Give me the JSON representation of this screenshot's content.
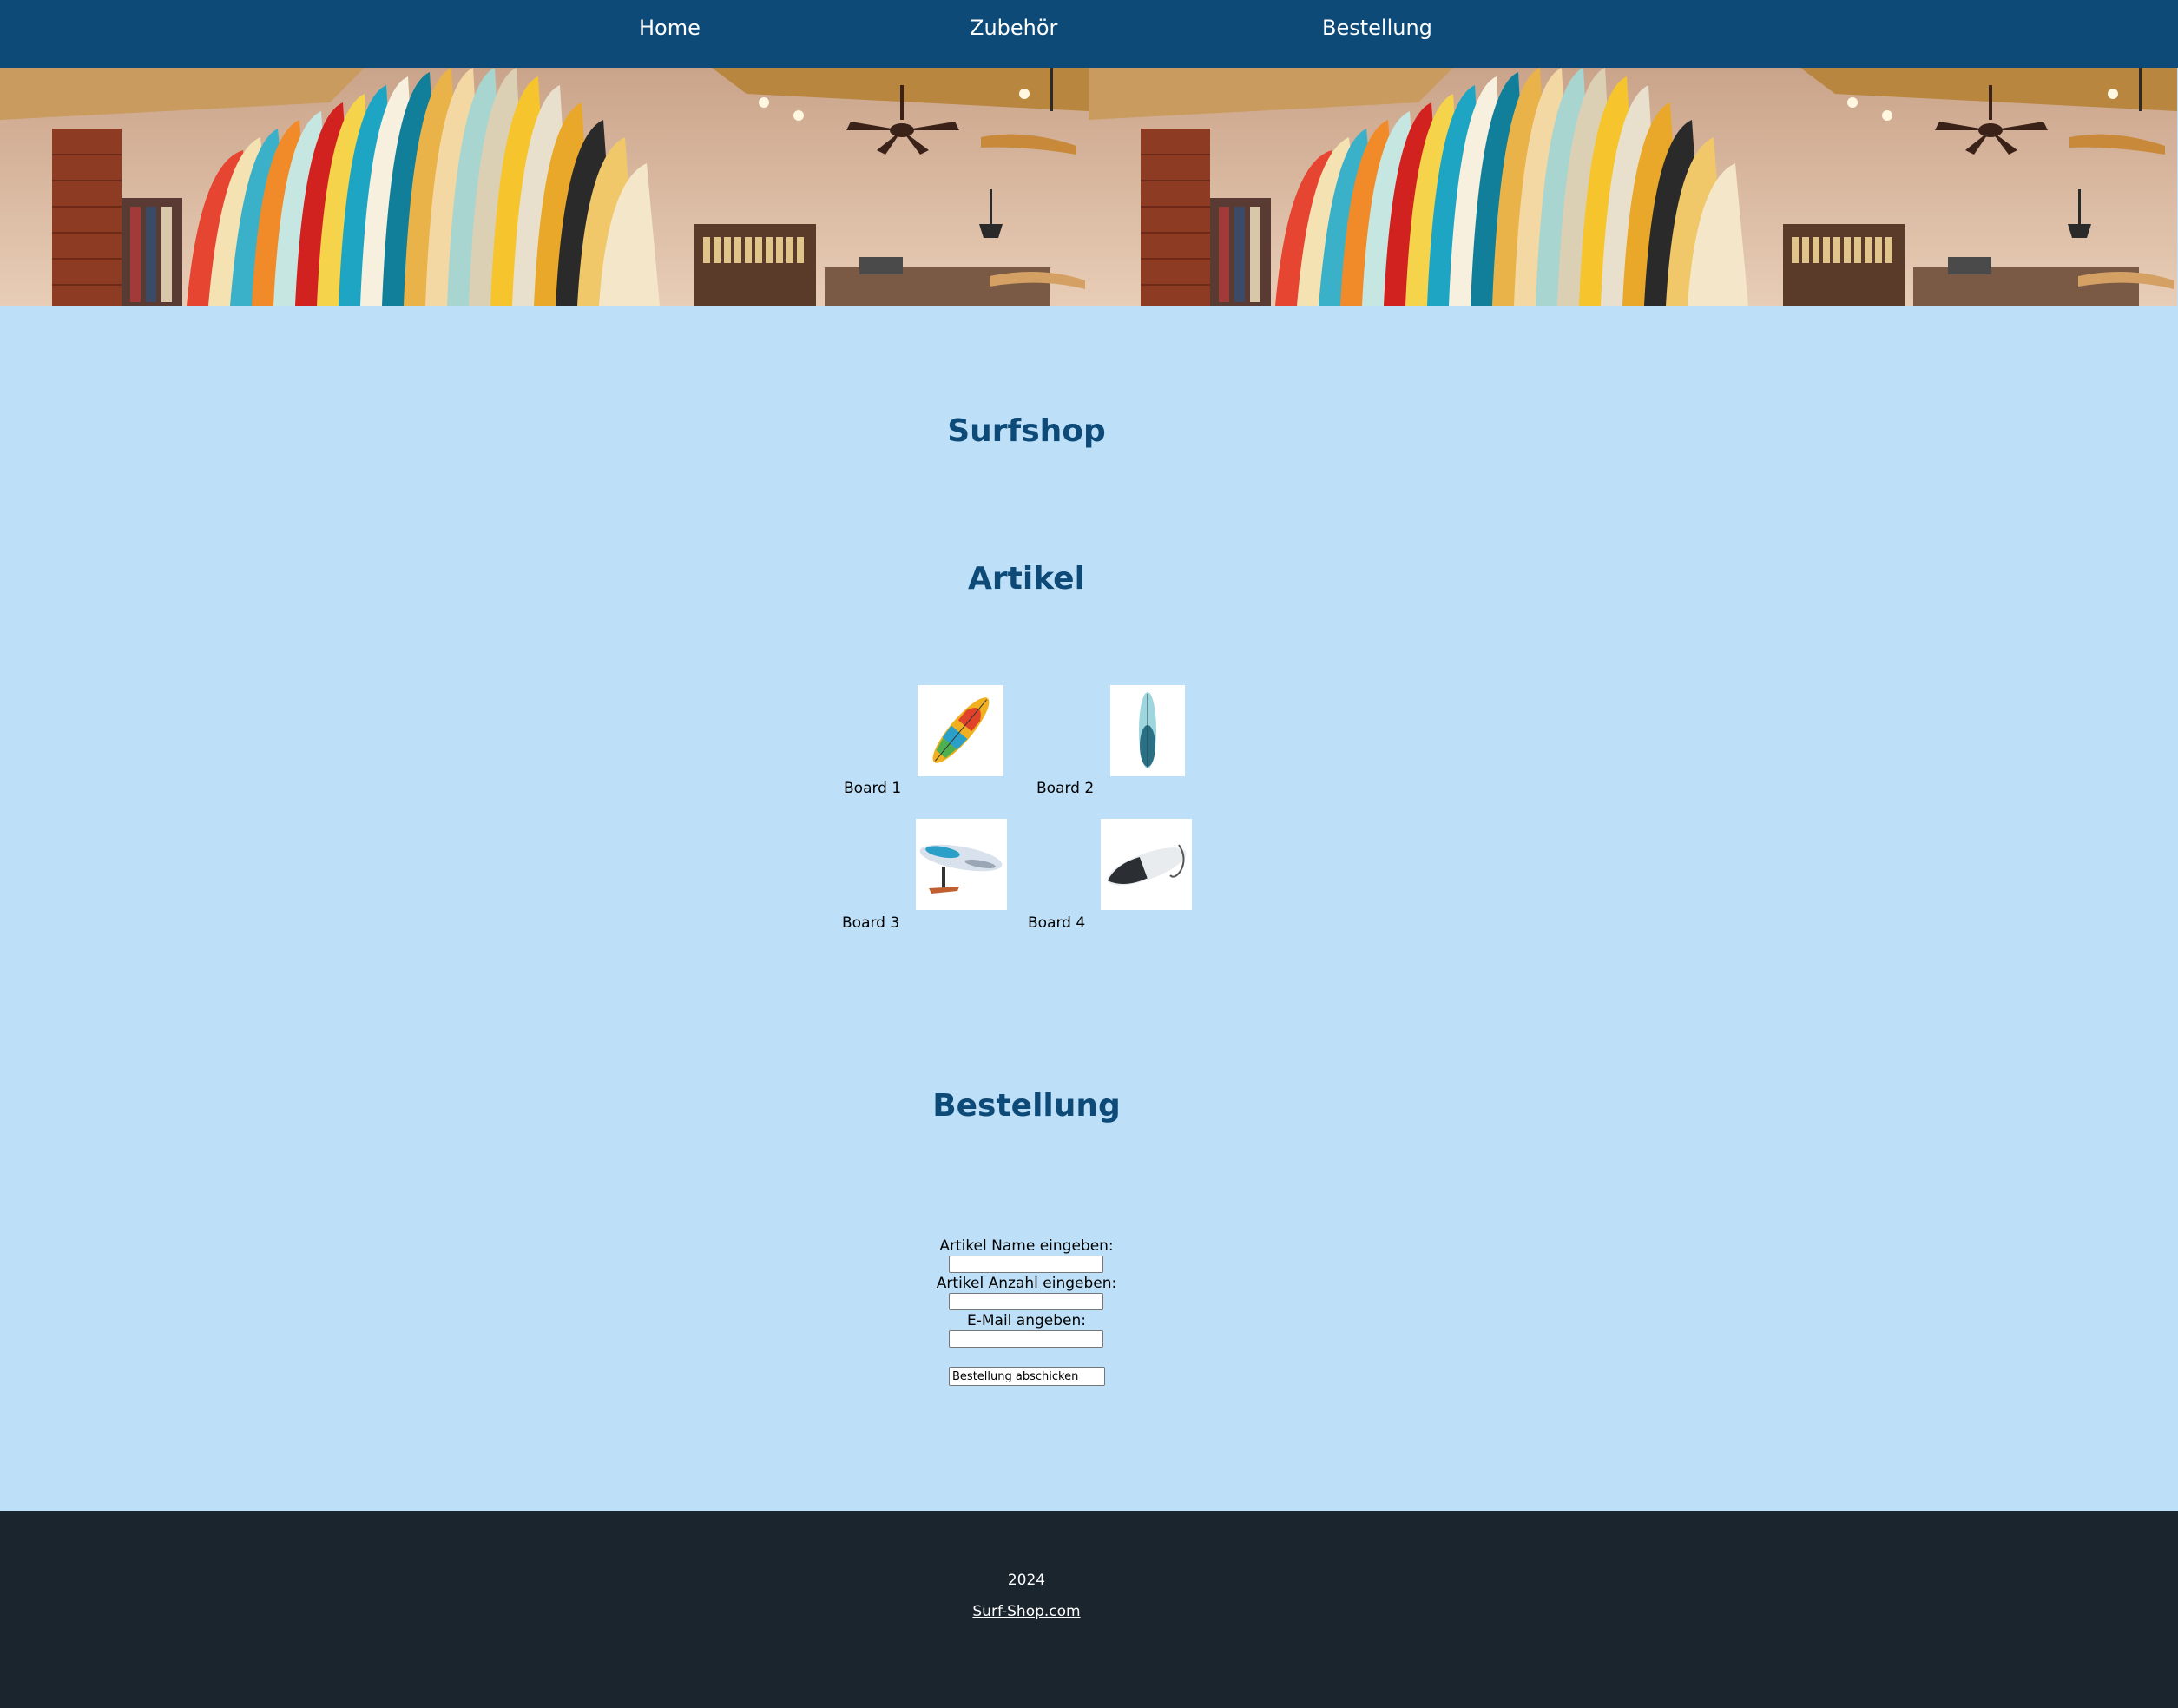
{
  "nav": {
    "items": [
      {
        "label": "Home"
      },
      {
        "label": "Zubehör"
      },
      {
        "label": "Bestellung"
      }
    ]
  },
  "hero": {
    "icon": "surf-shop-interior-photo"
  },
  "main": {
    "title": "Surfshop",
    "articles_heading": "Artikel",
    "products": [
      {
        "label": "Board 1"
      },
      {
        "label": "Board 2"
      },
      {
        "label": "Board 3"
      },
      {
        "label": "Board 4"
      }
    ]
  },
  "order": {
    "heading": "Bestellung",
    "name_label": "Artikel Name eingeben:",
    "name_value": "",
    "qty_label": "Artikel Anzahl eingeben:",
    "qty_value": "",
    "email_label": "E-Mail angeben:",
    "email_value": "",
    "submit_label": "Bestellung abschicken"
  },
  "footer": {
    "year": "2024",
    "link": "Surf-Shop.com"
  },
  "colors": {
    "nav_bg": "#0e4a78",
    "page_bg": "#bde0f8",
    "heading": "#0e4a78",
    "footer_bg": "#1b252d"
  }
}
